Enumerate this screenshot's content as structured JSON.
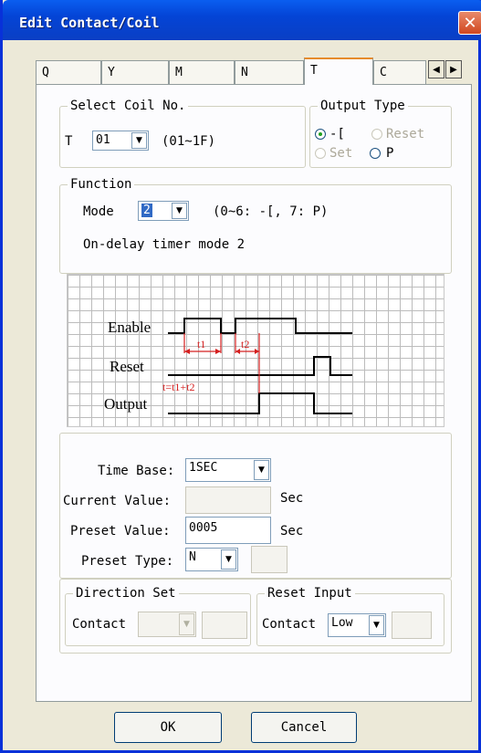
{
  "window": {
    "title": "Edit Contact/Coil",
    "close_glyph": "✕"
  },
  "tabs": [
    {
      "label": "Q"
    },
    {
      "label": "Y"
    },
    {
      "label": "M"
    },
    {
      "label": "N"
    },
    {
      "label": "T"
    },
    {
      "label": "C"
    }
  ],
  "tab_scroll": {
    "left": "◀",
    "right": "▶"
  },
  "select_coil": {
    "legend": "Select Coil No.",
    "prefix": "T",
    "value": "01",
    "range": "(01~1F)"
  },
  "output_type": {
    "legend": "Output Type",
    "options": [
      {
        "label": "-[",
        "checked": true,
        "enabled": true
      },
      {
        "label": "Reset",
        "checked": false,
        "enabled": false
      },
      {
        "label": "Set",
        "checked": false,
        "enabled": false
      },
      {
        "label": "P",
        "checked": false,
        "enabled": true
      }
    ]
  },
  "function": {
    "legend": "Function",
    "mode_label": "Mode",
    "mode_value": "2",
    "mode_hint": "(0~6: -[, 7: P)",
    "description": "On-delay timer mode 2"
  },
  "diagram": {
    "signals": [
      "Enable",
      "Reset",
      "Output"
    ],
    "annotations": [
      "t1",
      "t2",
      "t=t1+t2"
    ]
  },
  "timer": {
    "time_base_label": "Time Base:",
    "time_base_value": "1SEC",
    "current_value_label": "Current Value:",
    "current_value": "",
    "current_unit": "Sec",
    "preset_value_label": "Preset Value:",
    "preset_value": "0005",
    "preset_unit": "Sec",
    "preset_type_label": "Preset Type:",
    "preset_type_value": "N",
    "preset_extra": ""
  },
  "direction_set": {
    "legend": "Direction Set",
    "contact_label": "Contact",
    "contact_value": "",
    "contact_extra": ""
  },
  "reset_input": {
    "legend": "Reset Input",
    "contact_label": "Contact",
    "contact_value": "Low",
    "contact_extra": ""
  },
  "buttons": {
    "ok": "OK",
    "cancel": "Cancel"
  },
  "colors": {
    "title_bar": "#0a5ef0",
    "dialog_bg": "#ece9d8",
    "annotation_red": "#d42020",
    "selection": "#316ac5"
  }
}
